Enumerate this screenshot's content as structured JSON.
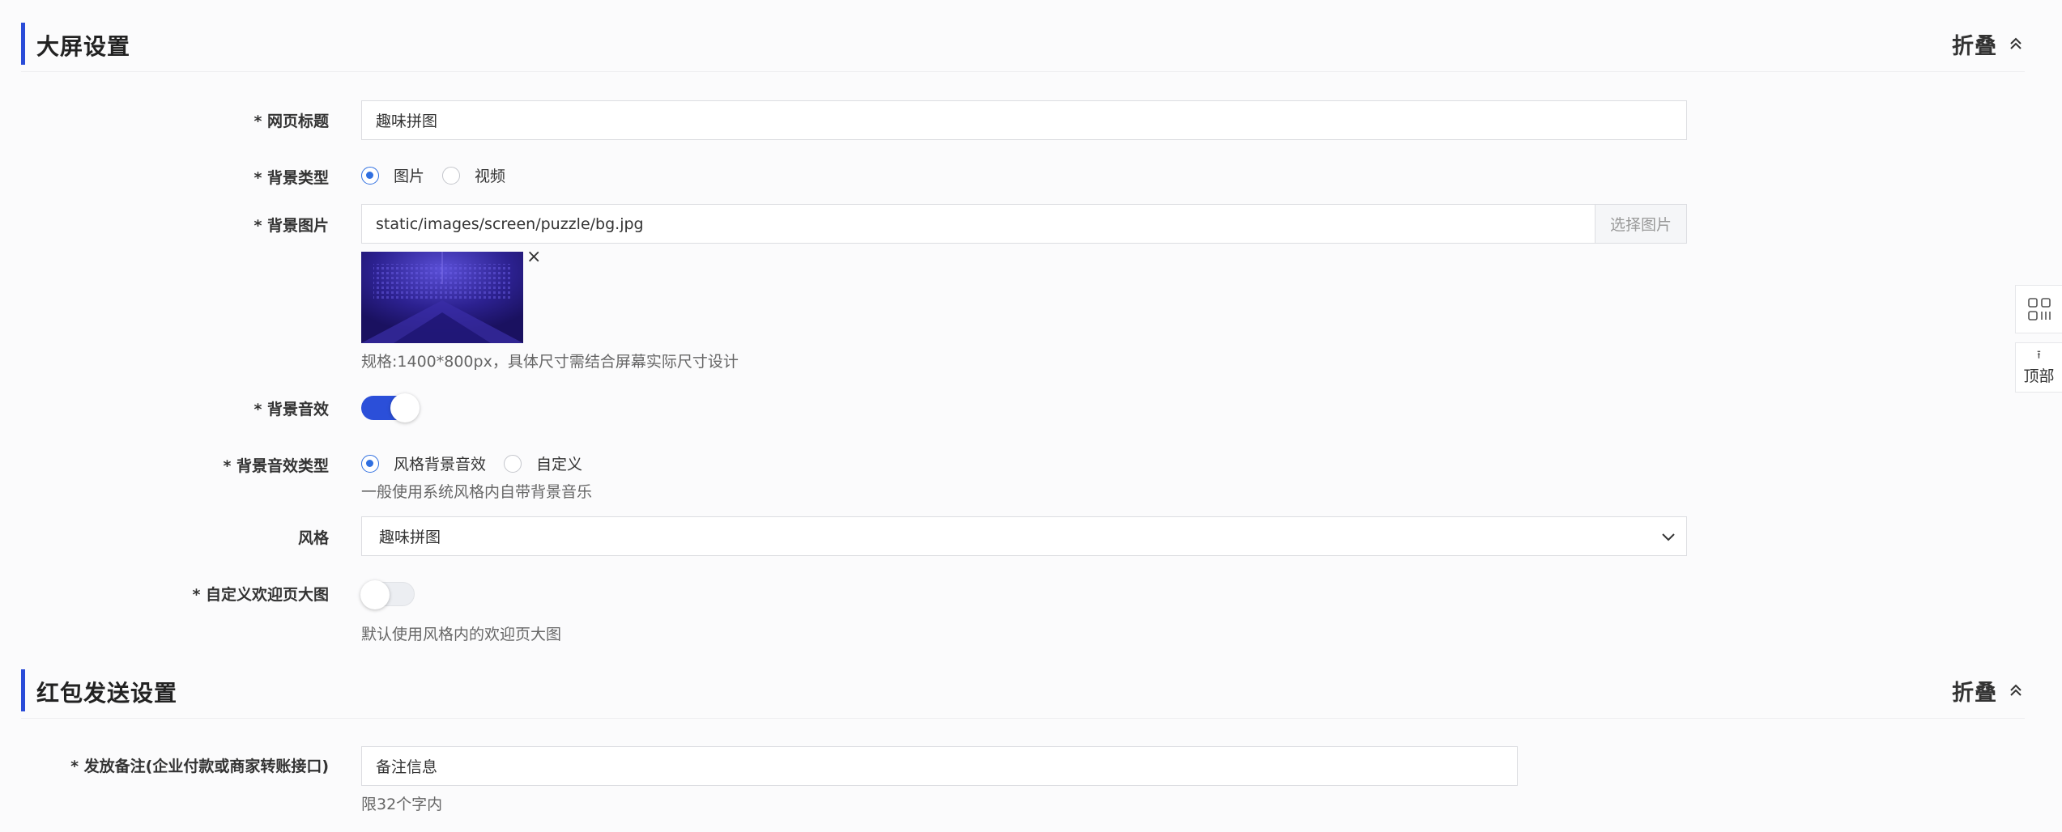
{
  "screen_settings": {
    "title": "大屏设置",
    "collapse_label": "折叠",
    "fields": {
      "page_title": {
        "label": "* 网页标题",
        "value": "趣味拼图"
      },
      "bg_type": {
        "label": "* 背景类型",
        "options": [
          "图片",
          "视频"
        ],
        "selected": "图片"
      },
      "bg_image": {
        "label": "* 背景图片",
        "value": "static/images/screen/puzzle/bg.jpg",
        "button": "选择图片",
        "remove_symbol": "×",
        "hint": "规格:1400*800px，具体尺寸需结合屏幕实际尺寸设计"
      },
      "bg_sound": {
        "label": "* 背景音效",
        "enabled": true
      },
      "bg_sound_type": {
        "label": "* 背景音效类型",
        "options": [
          "风格背景音效",
          "自定义"
        ],
        "selected": "风格背景音效",
        "hint": "一般使用系统风格内自带背景音乐"
      },
      "style": {
        "label": "风格",
        "value": "趣味拼图"
      },
      "custom_welcome": {
        "label": "* 自定义欢迎页大图",
        "enabled": false,
        "hint": "默认使用风格内的欢迎页大图"
      }
    }
  },
  "redpacket_settings": {
    "title": "红包发送设置",
    "collapse_label": "折叠",
    "fields": {
      "remark": {
        "label": "* 发放备注(企业付款或商家转账接口)",
        "value": "备注信息",
        "hint": "限32个字内"
      }
    }
  },
  "side_tools": {
    "top_label": "顶部",
    "top_arrow": "⭱"
  },
  "colors": {
    "accent": "#2a4cd8",
    "radio": "#2f6fe0"
  }
}
